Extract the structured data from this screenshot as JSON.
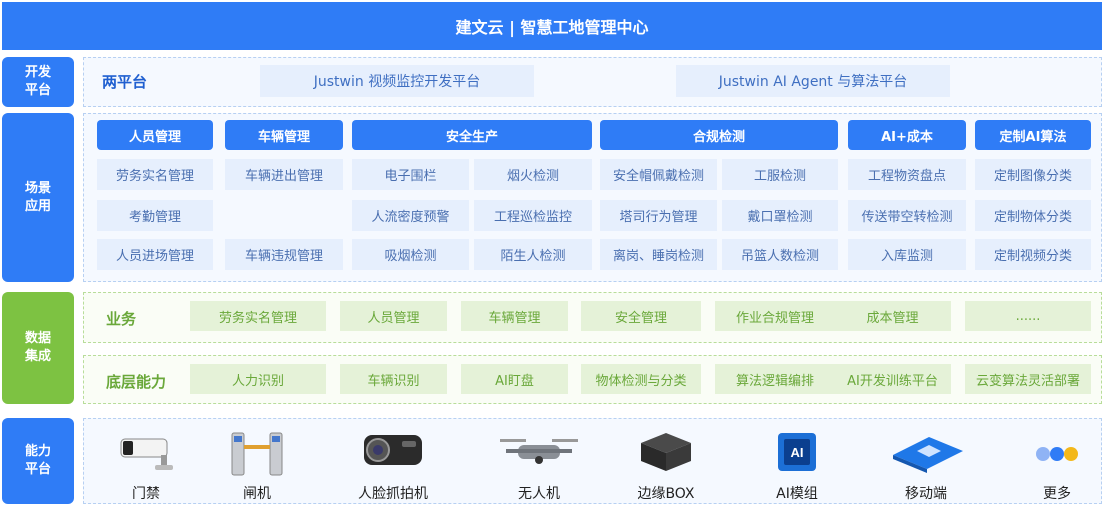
{
  "header": {
    "title": "建文云 | 智慧工地管理中心"
  },
  "sides": {
    "dev_platform": "开发\n平台",
    "scenario": "场景\n应用",
    "data": "数据\n集成",
    "ability": "能力\n平台"
  },
  "dev_platform": {
    "title": "两平台",
    "items": [
      "Justwin 视频监控开发平台",
      "Justwin AI Agent 与算法平台"
    ]
  },
  "categories": [
    {
      "label": "人员管理",
      "items": [
        "劳务实名管理",
        "考勤管理",
        "人员进场管理"
      ]
    },
    {
      "label": "车辆管理",
      "items": [
        "车辆进出管理",
        "",
        "车辆违规管理"
      ]
    },
    {
      "label": "安全生产",
      "items": [
        "电子围栏",
        "烟火检测",
        "人流密度预警",
        "工程巡检监控",
        "吸烟检测",
        "陌生人检测"
      ]
    },
    {
      "label": "合规检测",
      "items": [
        "安全帽佩戴检测",
        "工服检测",
        "塔司行为管理",
        "戴口罩检测",
        "离岗、睡岗检测",
        "吊篮人数检测"
      ]
    },
    {
      "label": "AI+成本",
      "items": [
        "工程物资盘点",
        "传送带空转检测",
        "入库监测"
      ]
    },
    {
      "label": "定制AI算法",
      "items": [
        "定制图像分类",
        "定制物体分类",
        "定制视频分类"
      ]
    }
  ],
  "business": {
    "title": "业务",
    "items": [
      "劳务实名管理",
      "人员管理",
      "车辆管理",
      "安全管理",
      "作业合规管理",
      "成本管理",
      "......"
    ]
  },
  "base": {
    "title": "底层能力",
    "items": [
      "人力识别",
      "车辆识别",
      "AI盯盘",
      "物体检测与分类",
      "算法逻辑编排",
      "AI开发训练平台",
      "云变算法灵活部署"
    ]
  },
  "devices": [
    {
      "label": "门禁",
      "icon": "camera-bullet-icon"
    },
    {
      "label": "闸机",
      "icon": "turnstile-icon"
    },
    {
      "label": "人脸抓拍机",
      "icon": "face-camera-icon"
    },
    {
      "label": "无人机",
      "icon": "drone-icon"
    },
    {
      "label": "边缘BOX",
      "icon": "edge-box-icon"
    },
    {
      "label": "AI模组",
      "icon": "ai-chip-icon"
    },
    {
      "label": "移动端",
      "icon": "mobile-chip-icon"
    },
    {
      "label": "更多",
      "icon": "more-dots-icon"
    }
  ],
  "colors": {
    "primary": "#2f7cf6",
    "green": "#7dc242",
    "cell_bg": "#e6effd",
    "green_cell_bg": "#e5f2d8"
  }
}
